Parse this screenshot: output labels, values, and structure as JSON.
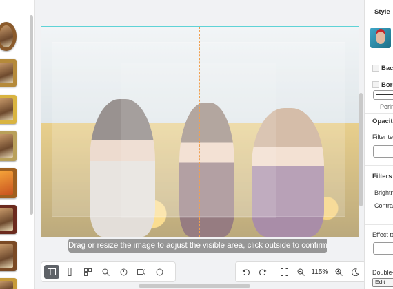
{
  "left_panel": {
    "thumbnails": [
      {
        "name": "round-portrait-frame"
      },
      {
        "name": "ornate-gold-frame"
      },
      {
        "name": "gold-frame"
      },
      {
        "name": "classic-frame"
      },
      {
        "name": "baroque-frame"
      },
      {
        "name": "wood-frame"
      },
      {
        "name": "brown-frame"
      },
      {
        "name": "gold-frame-2"
      }
    ]
  },
  "canvas": {
    "hint_text": "Drag or resize the image to adjust the visible area, click outside to confirm"
  },
  "toolbar_left": {
    "buttons": [
      "layout-icon",
      "split-icon",
      "grid-icon",
      "search-icon",
      "timer-icon",
      "video-icon",
      "zoom-icon"
    ]
  },
  "toolbar_right": {
    "zoom_level": "115%"
  },
  "right_panel": {
    "style_label": "Style",
    "background_label": "Back",
    "border_label": "Bord",
    "perimeter_label": "Perim",
    "opacity_label": "Opacity",
    "filter_template_label": "Filter tem",
    "filters_label": "Filters",
    "brightness_label": "Brightne",
    "contrast_label": "Contrast",
    "effect_template_label": "Effect tem",
    "double_click_label": "Double-c",
    "edit_label": "Edit"
  }
}
